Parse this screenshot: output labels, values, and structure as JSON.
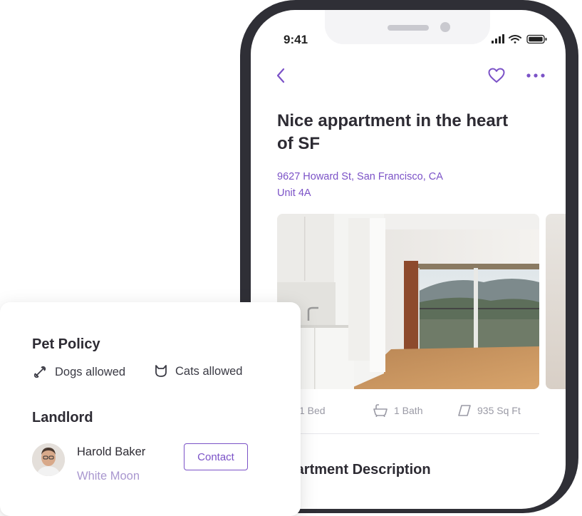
{
  "status_bar": {
    "time": "9:41"
  },
  "listing": {
    "title": "Nice appartment in the heart of SF",
    "address_line1": "9627 Howard St, San Francisco, CA",
    "address_line2": "Unit 4A",
    "features": [
      {
        "icon": "bed-icon",
        "label": "1 Bed"
      },
      {
        "icon": "bath-icon",
        "label": "1 Bath"
      },
      {
        "icon": "area-icon",
        "label": "935 Sq Ft"
      }
    ],
    "description_title": "Apartment Description"
  },
  "pet_policy": {
    "title": "Pet Policy",
    "items": [
      {
        "icon": "bone-icon",
        "label": "Dogs allowed"
      },
      {
        "icon": "cat-icon",
        "label": "Cats allowed"
      }
    ]
  },
  "landlord": {
    "title": "Landlord",
    "name": "Harold Baker",
    "company": "White Moon",
    "contact_label": "Contact"
  },
  "colors": {
    "accent": "#7b52c7",
    "phone_frame": "#2f2f36",
    "text": "#2d2b33",
    "muted": "#9a9aa5"
  }
}
